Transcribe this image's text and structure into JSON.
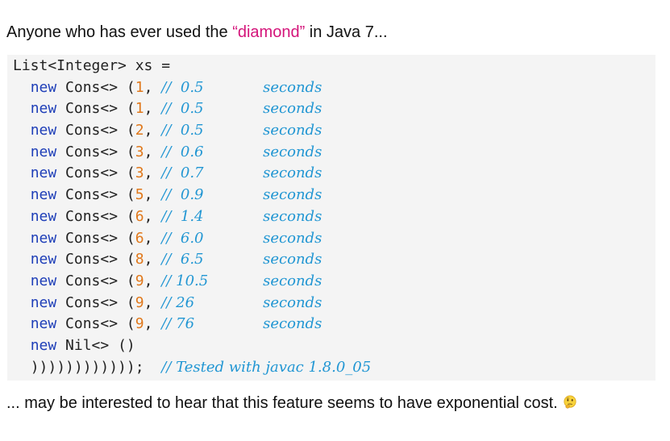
{
  "intro": {
    "before": "Anyone who has ever used the ",
    "highlight": "“diamond”",
    "after": " in Java 7..."
  },
  "code": {
    "header": "List<Integer> xs =",
    "keyword": "new",
    "ctor": "Cons<>",
    "rows": [
      {
        "num": "1",
        "time": " 0.5"
      },
      {
        "num": "1",
        "time": " 0.5"
      },
      {
        "num": "2",
        "time": " 0.5"
      },
      {
        "num": "3",
        "time": " 0.6"
      },
      {
        "num": "3",
        "time": " 0.7"
      },
      {
        "num": "5",
        "time": " 0.9"
      },
      {
        "num": "6",
        "time": " 1.4"
      },
      {
        "num": "6",
        "time": " 6.0"
      },
      {
        "num": "8",
        "time": " 6.5"
      },
      {
        "num": "9",
        "time": "10.5"
      },
      {
        "num": "9",
        "time": "26"
      },
      {
        "num": "9",
        "time": "76"
      }
    ],
    "unit": "seconds",
    "nil_line": "Nil<> ()",
    "closing": "))))))))))));",
    "closing_comment": "// Tested with javac 1.8.0_05"
  },
  "outro": {
    "text": "... may be interested to hear that this feature seems to have exponential cost.",
    "emoji_icon": "thinking-face-icon"
  }
}
